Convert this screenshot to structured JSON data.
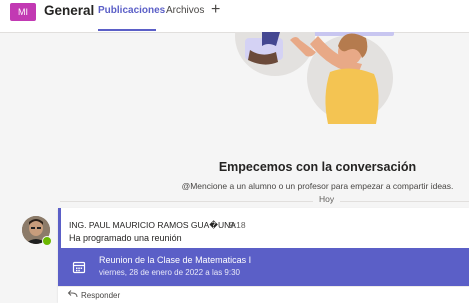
{
  "header": {
    "team_initials": "MI",
    "team_name": "General",
    "tabs": [
      {
        "label": "Publicaciones",
        "active": true
      },
      {
        "label": "Archivos",
        "active": false
      }
    ],
    "add_tab_symbol": "+"
  },
  "empty_state": {
    "title": "Empecemos con la conversación",
    "subtitle": "@Mencione a un alumno o un profesor para empezar a compartir ideas."
  },
  "divider": {
    "label": "Hoy"
  },
  "post": {
    "author": "ING. PAUL MAURICIO RAMOS GUA�UNA",
    "time": "9:18",
    "text": "Ha programado una reunión",
    "meeting": {
      "title": "Reunion de la Clase de Matematicas I",
      "date": "viernes, 28 de enero de 2022 a las 9:30"
    },
    "reply_label": "Responder"
  },
  "icons": {
    "calendar": "calendar-icon",
    "reply": "reply-arrow-icon",
    "presence": "presence-available-icon"
  },
  "colors": {
    "accent": "#5b5fc7",
    "team_avatar": "#c239b3",
    "presence_available": "#6bb700",
    "background": "#f5f5f5"
  }
}
